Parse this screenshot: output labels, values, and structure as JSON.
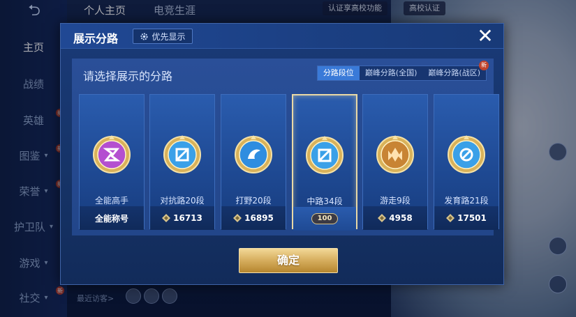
{
  "background": {
    "back_label": "⮌",
    "top_tabs": [
      "个人主页",
      "电竞生涯"
    ],
    "top_pills": [
      "认证享高校功能",
      "高校认证"
    ],
    "sidebar": [
      {
        "label": "主页",
        "active": true,
        "chevron": false,
        "new": false
      },
      {
        "label": "战绩",
        "active": false,
        "chevron": false,
        "new": false
      },
      {
        "label": "英雄",
        "active": false,
        "chevron": false,
        "new": true
      },
      {
        "label": "图鉴",
        "active": false,
        "chevron": true,
        "new": true
      },
      {
        "label": "荣誉",
        "active": false,
        "chevron": true,
        "new": true
      },
      {
        "label": "护卫队",
        "active": false,
        "chevron": true,
        "new": false
      },
      {
        "label": "游戏",
        "active": false,
        "chevron": true,
        "new": false
      },
      {
        "label": "社交",
        "active": false,
        "chevron": true,
        "new": true
      }
    ],
    "recent_visitors": "最近访客>"
  },
  "modal": {
    "title": "展示分路",
    "priority_label": "优先显示",
    "close_label": "✕",
    "prompt": "请选择展示的分路",
    "tabs": [
      {
        "label": "分路段位",
        "active": true,
        "new": false
      },
      {
        "label": "巅峰分路(全国)",
        "active": false,
        "new": false
      },
      {
        "label": "巅峰分路(战区)",
        "active": false,
        "new": true
      }
    ],
    "new_badge": "新",
    "cards": [
      {
        "label": "全能高手",
        "score": "全能称号",
        "selected": false,
        "icon": "allround-emblem-icon",
        "color": "#b44fd0"
      },
      {
        "label": "对抗路20段",
        "score": "16713",
        "selected": false,
        "icon": "clash-lane-emblem-icon",
        "color": "#3aa0e8"
      },
      {
        "label": "打野20段",
        "score": "16895",
        "selected": false,
        "icon": "jungle-emblem-icon",
        "color": "#2f8de0"
      },
      {
        "label": "中路34段",
        "score": "100",
        "selected": true,
        "icon": "mid-lane-emblem-icon",
        "color": "#3aa0e8"
      },
      {
        "label": "游走9段",
        "score": "4958",
        "selected": false,
        "icon": "roam-emblem-icon",
        "color": "#c88434"
      },
      {
        "label": "发育路21段",
        "score": "17501",
        "selected": false,
        "icon": "farm-lane-emblem-icon",
        "color": "#3aa0e8"
      }
    ],
    "confirm_label": "确定"
  }
}
